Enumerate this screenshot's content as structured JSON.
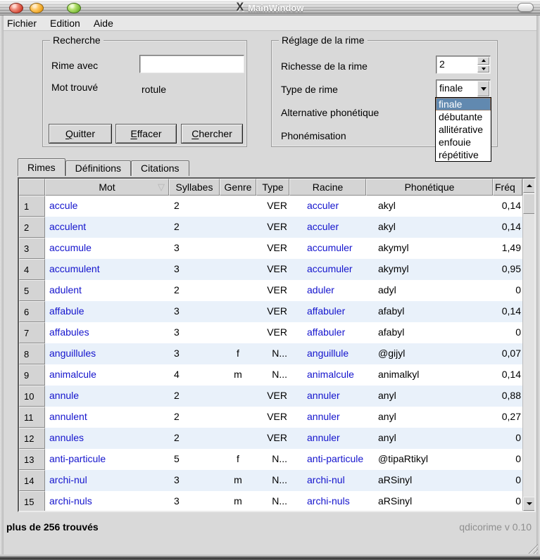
{
  "window": {
    "title": "MainWindow",
    "menu": [
      {
        "label": "Fichier"
      },
      {
        "label": "Edition"
      },
      {
        "label": "Aide"
      }
    ]
  },
  "recherche": {
    "title": "Recherche",
    "rime_avec": {
      "label": "Rime avec",
      "value": ""
    },
    "mot_trouve": {
      "label": "Mot trouvé",
      "value": "rotule"
    },
    "buttons": [
      {
        "label": "Quitter"
      },
      {
        "label": "Effacer"
      },
      {
        "label": "Chercher"
      }
    ]
  },
  "reglage": {
    "title": "Réglage de la rime",
    "richesse": {
      "label": "Richesse de la rime",
      "value": "2"
    },
    "type_rime": {
      "label": "Type de rime",
      "value": "finale",
      "options": [
        "finale",
        "débutante",
        "allitérative",
        "enfouie",
        "répétitive"
      ],
      "selected_index": 0
    },
    "alternative": {
      "label": "Alternative phonétique"
    },
    "phonemisation": {
      "label": "Phonémisation"
    }
  },
  "tabs": [
    {
      "label": "Rimes"
    },
    {
      "label": "Définitions"
    },
    {
      "label": "Citations"
    }
  ],
  "table": {
    "columns": [
      "",
      "Mot",
      "Syllabes",
      "Genre",
      "Type",
      "Racine",
      "Phonétique",
      "Fréq"
    ],
    "sort_column": "Mot",
    "sort_icon": "▽",
    "rows": [
      {
        "n": "1",
        "mot": "accule",
        "syllabes": "2",
        "genre": "",
        "type": "VER",
        "racine": "acculer",
        "phonetique": "akyl",
        "freq": "0,14"
      },
      {
        "n": "2",
        "mot": "acculent",
        "syllabes": "2",
        "genre": "",
        "type": "VER",
        "racine": "acculer",
        "phonetique": "akyl",
        "freq": "0,14"
      },
      {
        "n": "3",
        "mot": "accumule",
        "syllabes": "3",
        "genre": "",
        "type": "VER",
        "racine": "accumuler",
        "phonetique": "akymyl",
        "freq": "1,49"
      },
      {
        "n": "4",
        "mot": "accumulent",
        "syllabes": "3",
        "genre": "",
        "type": "VER",
        "racine": "accumuler",
        "phonetique": "akymyl",
        "freq": "0,95"
      },
      {
        "n": "5",
        "mot": "adulent",
        "syllabes": "2",
        "genre": "",
        "type": "VER",
        "racine": "aduler",
        "phonetique": "adyl",
        "freq": "0"
      },
      {
        "n": "6",
        "mot": "affabule",
        "syllabes": "3",
        "genre": "",
        "type": "VER",
        "racine": "affabuler",
        "phonetique": "afabyl",
        "freq": "0,14"
      },
      {
        "n": "7",
        "mot": "affabules",
        "syllabes": "3",
        "genre": "",
        "type": "VER",
        "racine": "affabuler",
        "phonetique": "afabyl",
        "freq": "0"
      },
      {
        "n": "8",
        "mot": "anguillules",
        "syllabes": "3",
        "genre": "f",
        "type": "N...",
        "racine": "anguillule",
        "phonetique": "@gijyl",
        "freq": "0,07"
      },
      {
        "n": "9",
        "mot": "animalcule",
        "syllabes": "4",
        "genre": "m",
        "type": "N...",
        "racine": "animalcule",
        "phonetique": "animalkyl",
        "freq": "0,14"
      },
      {
        "n": "10",
        "mot": "annule",
        "syllabes": "2",
        "genre": "",
        "type": "VER",
        "racine": "annuler",
        "phonetique": "anyl",
        "freq": "0,88"
      },
      {
        "n": "11",
        "mot": "annulent",
        "syllabes": "2",
        "genre": "",
        "type": "VER",
        "racine": "annuler",
        "phonetique": "anyl",
        "freq": "0,27"
      },
      {
        "n": "12",
        "mot": "annules",
        "syllabes": "2",
        "genre": "",
        "type": "VER",
        "racine": "annuler",
        "phonetique": "anyl",
        "freq": "0"
      },
      {
        "n": "13",
        "mot": "anti-particule",
        "syllabes": "5",
        "genre": "f",
        "type": "N...",
        "racine": "anti-particule",
        "phonetique": "@tipaRtikyl",
        "freq": "0"
      },
      {
        "n": "14",
        "mot": "archi-nul",
        "syllabes": "3",
        "genre": "m",
        "type": "N...",
        "racine": "archi-nul",
        "phonetique": "aRSinyl",
        "freq": "0"
      },
      {
        "n": "15",
        "mot": "archi-nuls",
        "syllabes": "3",
        "genre": "m",
        "type": "N...",
        "racine": "archi-nuls",
        "phonetique": "aRSinyl",
        "freq": "0"
      }
    ]
  },
  "statusbar": {
    "left": "plus de 256 trouvés",
    "right": "qdicorime v 0.10"
  },
  "colors": {
    "highlight": "#6189b0",
    "link": "#1414cd",
    "alt_row": "#e9f1fa"
  }
}
